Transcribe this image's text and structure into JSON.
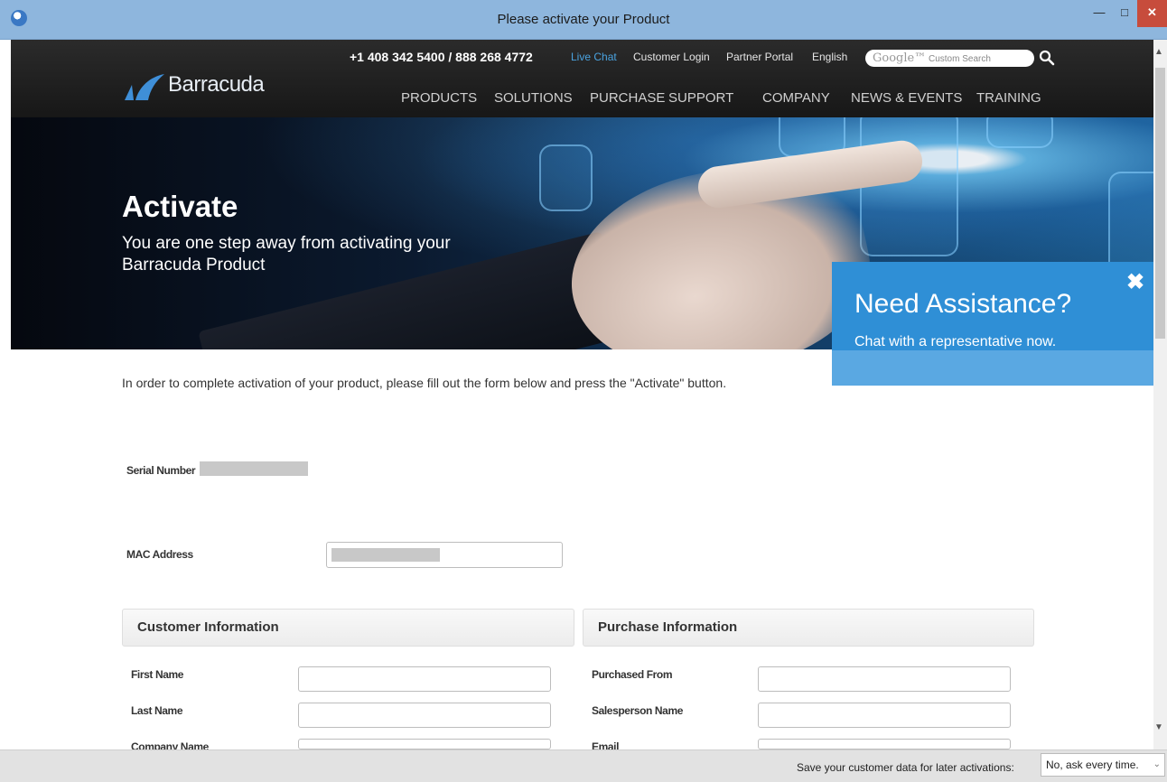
{
  "window": {
    "title": "Please activate your Product"
  },
  "header": {
    "phone": "+1 408 342 5400 / 888 268 4772",
    "links": {
      "live_chat": "Live Chat",
      "customer_login": "Customer Login",
      "partner_portal": "Partner Portal",
      "language": "English"
    },
    "search_placeholder": "Custom Search",
    "search_brand": "Google™",
    "logo_text": "Barracuda",
    "nav": [
      "PRODUCTS",
      "SOLUTIONS",
      "PURCHASE",
      "SUPPORT",
      "COMPANY",
      "NEWS & EVENTS",
      "TRAINING"
    ]
  },
  "hero": {
    "title": "Activate",
    "subtitle": "You are one step away from activating your Barracuda Product"
  },
  "assist": {
    "title": "Need Assistance?",
    "subtitle": "Chat with a representative now.",
    "close": "✖"
  },
  "form": {
    "intro": "In order to complete activation of your product, please fill out the form below and press the \"Activate\" button.",
    "serial_label": "Serial Number",
    "mac_label": "MAC Address",
    "customer_section": "Customer Information",
    "purchase_section": "Purchase Information",
    "customer_fields": [
      "First Name",
      "Last Name",
      "Company Name"
    ],
    "purchase_fields": [
      "Purchased From",
      "Salesperson Name",
      "Email"
    ]
  },
  "bottom": {
    "save_label": "Save your customer data for later activations:",
    "save_value": "No, ask every time."
  },
  "colors": {
    "titlebar": "#8eb6dd",
    "accent": "#2f8fd6",
    "link": "#4aa3e0",
    "close": "#c74c3c"
  }
}
